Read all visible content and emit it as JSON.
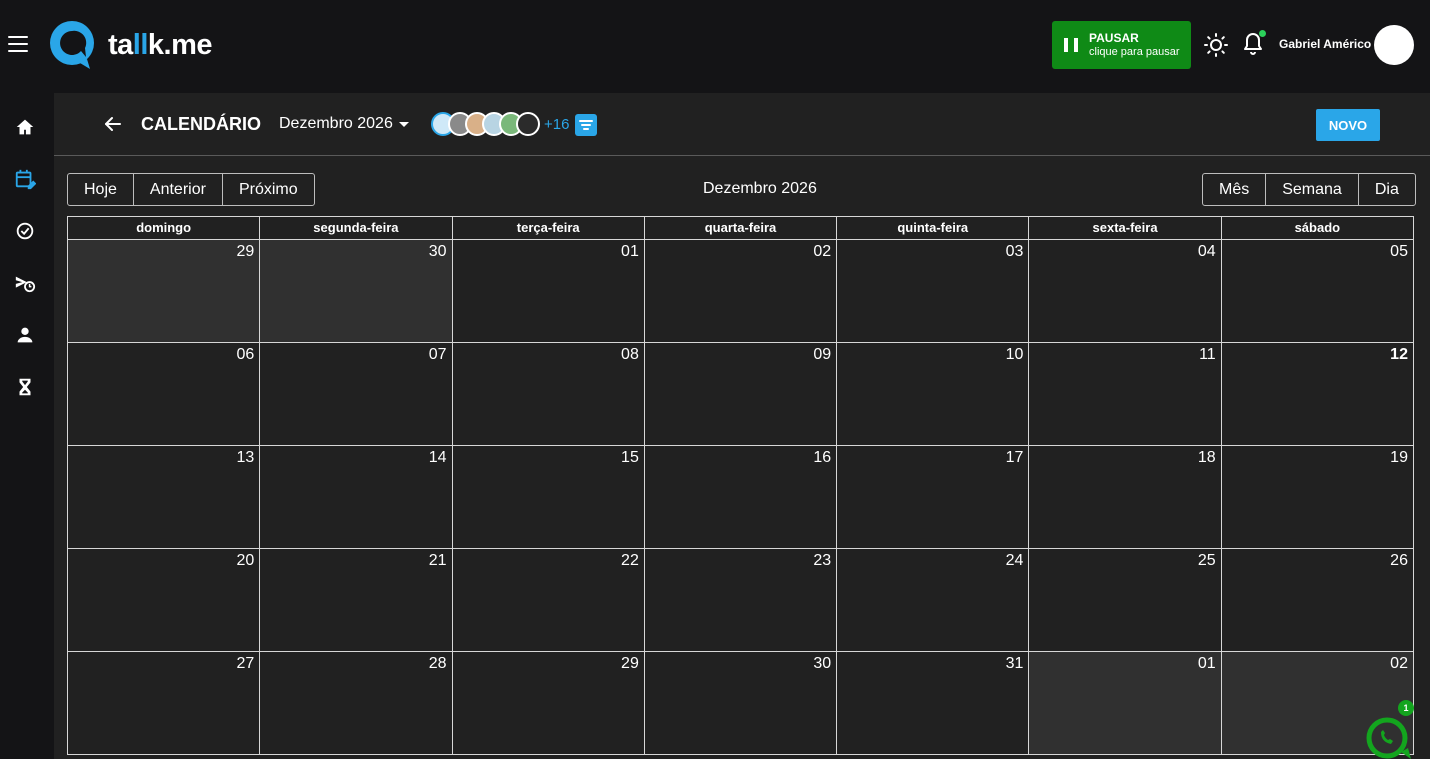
{
  "app": {
    "logo_text_start": "ta",
    "logo_text_accent": "ll",
    "logo_text_end": "k.me"
  },
  "topbar": {
    "pause_title": "PAUSAR",
    "pause_sub": "clique para pausar",
    "user_name": "Gabriel Américo"
  },
  "sidebar": {
    "items": [
      "home-icon",
      "calendar-edit-icon",
      "check-circle-icon",
      "scheduled-icon",
      "person-icon",
      "hourglass-icon"
    ],
    "active_index": 1
  },
  "header": {
    "title": "CALENDÁRIO",
    "month": "Dezembro 2026",
    "more_count": "+16",
    "new_label": "NOVO"
  },
  "toolbar": {
    "today": "Hoje",
    "prev": "Anterior",
    "next": "Próximo",
    "title": "Dezembro 2026",
    "month_view": "Mês",
    "week_view": "Semana",
    "day_view": "Dia"
  },
  "calendar": {
    "weekdays": [
      "domingo",
      "segunda-feira",
      "terça-feira",
      "quarta-feira",
      "quinta-feira",
      "sexta-feira",
      "sábado"
    ],
    "weeks": [
      [
        "29",
        "30",
        "01",
        "02",
        "03",
        "04",
        "05"
      ],
      [
        "06",
        "07",
        "08",
        "09",
        "10",
        "11",
        "12"
      ],
      [
        "13",
        "14",
        "15",
        "16",
        "17",
        "18",
        "19"
      ],
      [
        "20",
        "21",
        "22",
        "23",
        "24",
        "25",
        "26"
      ],
      [
        "27",
        "28",
        "29",
        "30",
        "31",
        "01",
        "02"
      ]
    ],
    "other_month_cells": [
      [
        0,
        0
      ],
      [
        0,
        1
      ],
      [
        4,
        5
      ],
      [
        4,
        6
      ]
    ],
    "today_cell": [
      1,
      6
    ]
  },
  "widget": {
    "badge": "1"
  },
  "colors": {
    "accent": "#2aa6e8",
    "pause_green": "#0f8a16",
    "online_dot": "#2bd15a",
    "widget_green": "#13a51e"
  }
}
